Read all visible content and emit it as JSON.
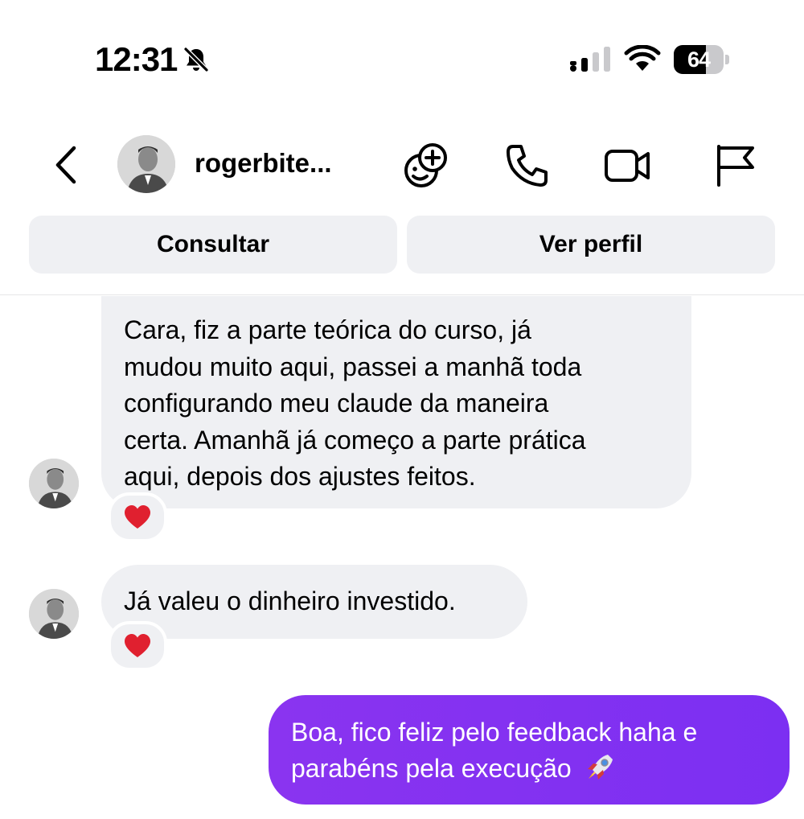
{
  "status_bar": {
    "time": "12:31",
    "battery_level": "64",
    "icons": [
      "bell-slash-icon",
      "cellular-signal-icon",
      "wifi-icon",
      "battery-icon"
    ]
  },
  "header": {
    "username": "rogerbite...",
    "icons": [
      "back-chevron-icon",
      "effects-icon",
      "phone-icon",
      "video-camera-icon",
      "flag-icon"
    ]
  },
  "actions": {
    "consult_label": "Consultar",
    "profile_label": "Ver perfil"
  },
  "messages": [
    {
      "direction": "incoming",
      "lines": [
        "Cara, fiz a parte teórica do curso, já",
        "mudou muito aqui, passei a manhã toda",
        "configurando meu claude da maneira",
        "certa. Amanhã já começo a parte prática",
        "aqui, depois dos ajustes feitos."
      ],
      "reaction": "heart-reaction-icon"
    },
    {
      "direction": "incoming",
      "lines": [
        "Já valeu o dinheiro investido."
      ],
      "reaction": "heart-reaction-icon"
    },
    {
      "direction": "outgoing",
      "lines": [
        "Boa, fico feliz pelo feedback haha e",
        "parabéns pela execução"
      ],
      "emoji": "rocket-icon"
    }
  ],
  "colors": {
    "outgoing_bubble": "#8a34f0",
    "incoming_bubble": "#eff0f3",
    "button_bg": "#eff0f3",
    "heart": "#e0202f"
  }
}
